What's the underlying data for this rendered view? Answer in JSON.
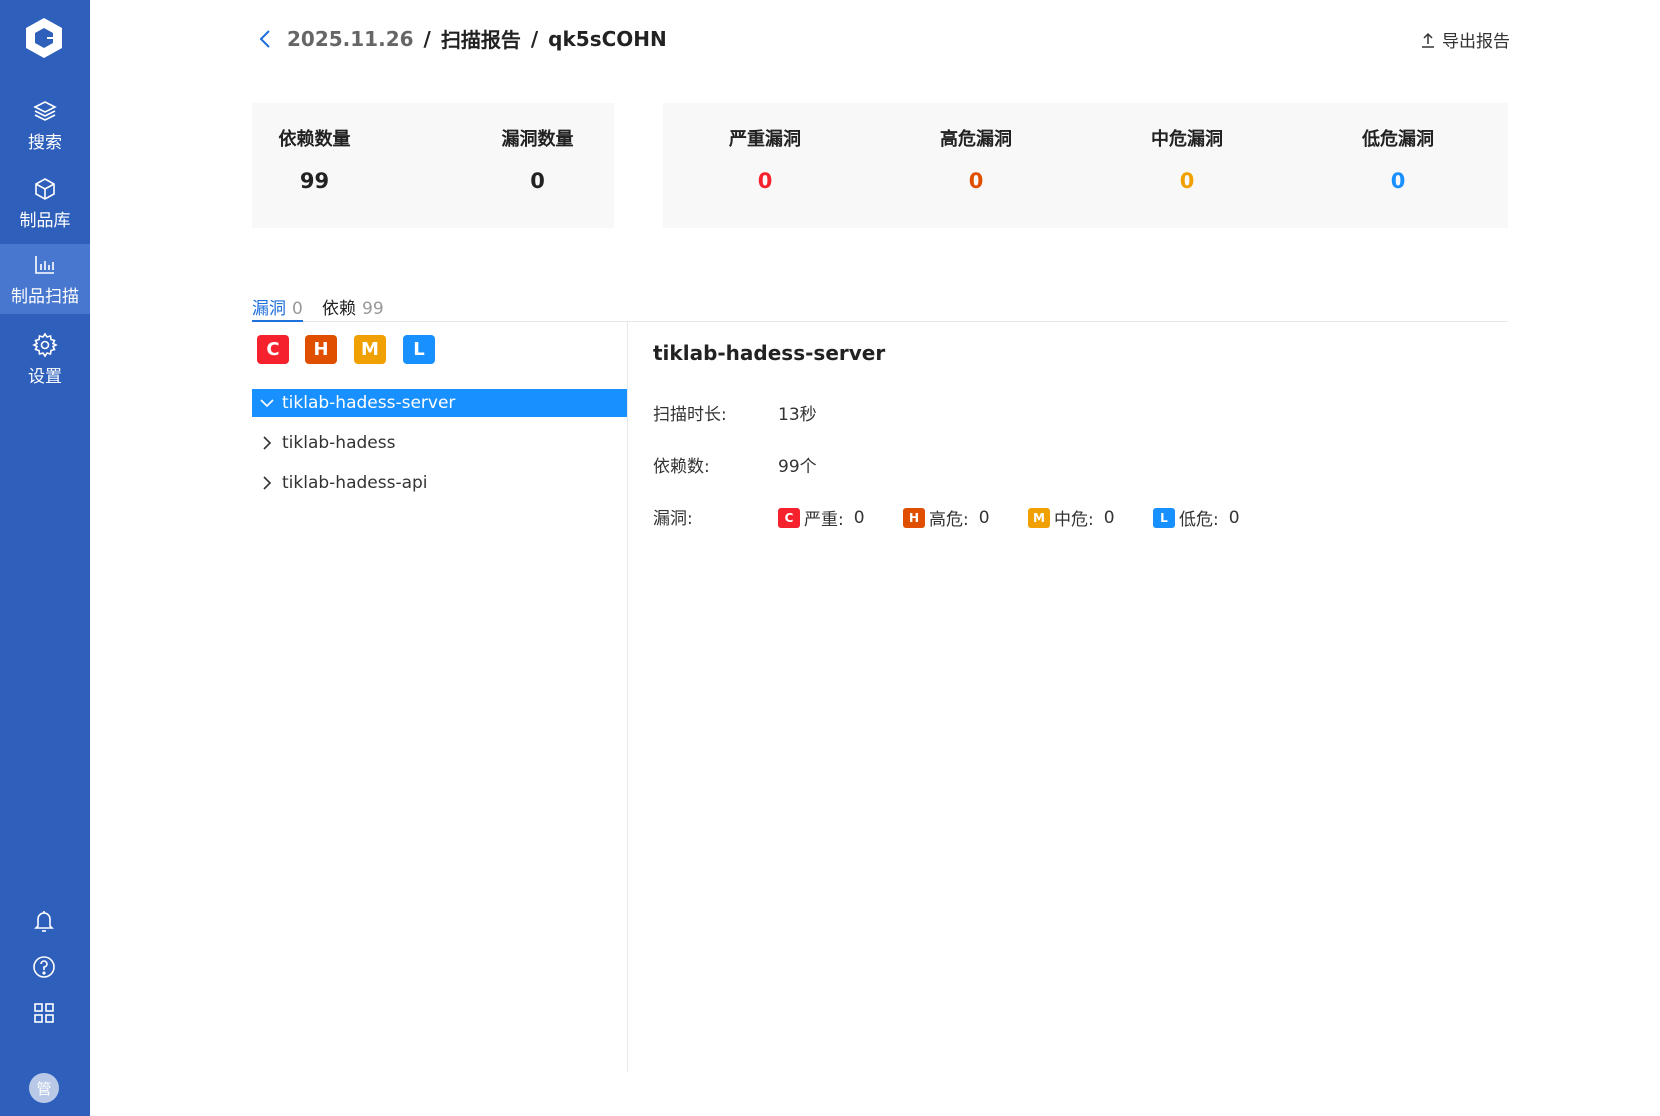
{
  "sidebar": {
    "items": [
      {
        "label": "搜索",
        "icon": "layers-icon"
      },
      {
        "label": "制品库",
        "icon": "cube-icon"
      },
      {
        "label": "制品扫描",
        "icon": "bar-chart-icon"
      },
      {
        "label": "设置",
        "icon": "gear-icon"
      }
    ],
    "active_index": 2,
    "avatar_text": "管"
  },
  "header": {
    "date": "2025.11.26",
    "separator": "/",
    "section": "扫描报告",
    "current": "qk5sCOHN",
    "export_label": "导出报告"
  },
  "stats": {
    "deps_label": "依赖数量",
    "deps_value": "99",
    "vulns_label": "漏洞数量",
    "vulns_value": "0",
    "critical_label": "严重漏洞",
    "critical_value": "0",
    "high_label": "高危漏洞",
    "high_value": "0",
    "medium_label": "中危漏洞",
    "medium_value": "0",
    "low_label": "低危漏洞",
    "low_value": "0"
  },
  "tabs": [
    {
      "label": "漏洞",
      "count": "0"
    },
    {
      "label": "依赖",
      "count": "99"
    }
  ],
  "severity_filters": [
    "C",
    "H",
    "M",
    "L"
  ],
  "tree": [
    {
      "label": "tiklab-hadess-server",
      "selected": true
    },
    {
      "label": "tiklab-hadess",
      "selected": false
    },
    {
      "label": "tiklab-hadess-api",
      "selected": false
    }
  ],
  "detail": {
    "title": "tiklab-hadess-server",
    "duration_label": "扫描时长:",
    "duration_value": "13秒",
    "deps_label": "依赖数:",
    "deps_value": "99个",
    "vuln_label": "漏洞:",
    "vulns": [
      {
        "badge": "C",
        "label": "严重:",
        "value": "0"
      },
      {
        "badge": "H",
        "label": "高危:",
        "value": "0"
      },
      {
        "badge": "M",
        "label": "中危:",
        "value": "0"
      },
      {
        "badge": "L",
        "label": "低危:",
        "value": "0"
      }
    ]
  },
  "colors": {
    "sidebar_bg": "#2e5fbb",
    "sidebar_active": "#4877cf",
    "critical": "#f5222d",
    "high": "#e04e00",
    "medium": "#f0a000",
    "low": "#1890ff",
    "selected_row": "#1890ff"
  }
}
